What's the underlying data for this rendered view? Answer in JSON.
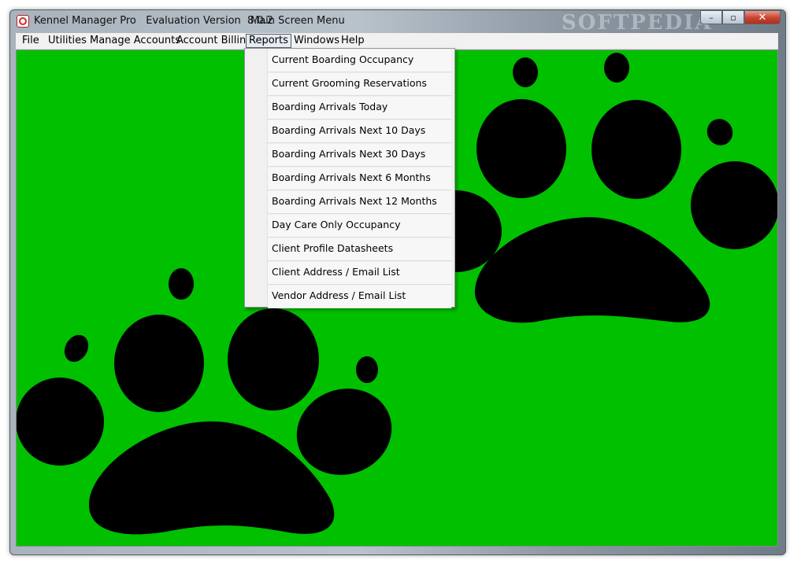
{
  "window": {
    "title": "Kennel Manager Pro   Evaluation Version  8.0.2",
    "subtitle": "Main Screen Menu",
    "watermark": "SOFTPEDIA",
    "controls": {
      "minimize": "–",
      "maximize": "▫",
      "close": "✕"
    }
  },
  "menubar": {
    "items": [
      {
        "label": "File"
      },
      {
        "label": "Utilities"
      },
      {
        "label": "Manage Accounts"
      },
      {
        "label": "Account Billing"
      },
      {
        "label": "Reports"
      },
      {
        "label": "Windows"
      },
      {
        "label": "Help"
      }
    ],
    "active": "Reports"
  },
  "reports_menu": {
    "items": [
      "Current Boarding Occupancy",
      "Current Grooming Reservations",
      "Boarding Arrivals Today",
      "Boarding Arrivals Next 10 Days",
      "Boarding Arrivals Next 30 Days",
      "Boarding Arrivals Next 6 Months",
      "Boarding Arrivals Next 12 Months",
      "Day Care Only Occupancy",
      "Client Profile Datasheets",
      "Client Address / Email List",
      "Vendor Address / Email List"
    ]
  },
  "colors": {
    "background": "#00c000",
    "paw": "#000000"
  }
}
